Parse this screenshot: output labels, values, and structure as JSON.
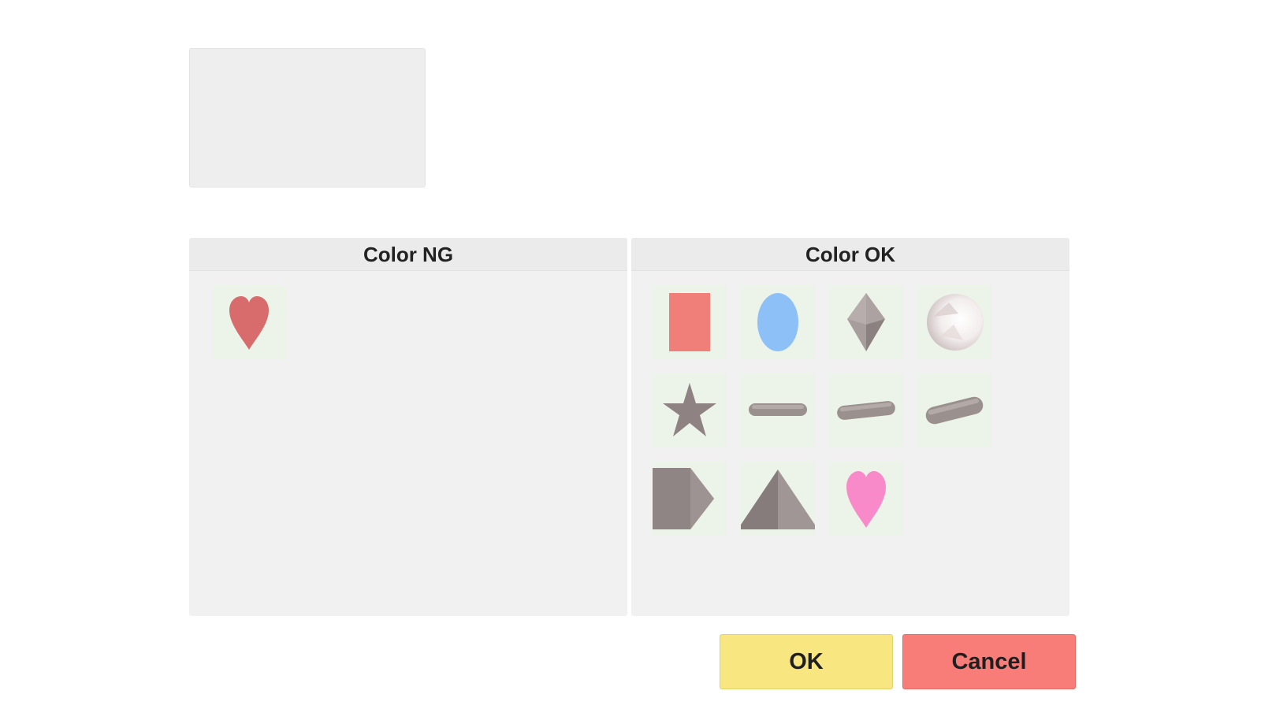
{
  "panels": {
    "ng": {
      "title": "Color NG"
    },
    "ok": {
      "title": "Color OK"
    }
  },
  "buttons": {
    "ok_label": "OK",
    "cancel_label": "Cancel"
  },
  "ng_items": [
    {
      "shape": "heart-icon",
      "color": "#d86b6b"
    }
  ],
  "ok_items": [
    {
      "shape": "rectangle-icon",
      "color": "#f07f7a"
    },
    {
      "shape": "oval-icon",
      "color": "#8ec0f8"
    },
    {
      "shape": "diamond-icon",
      "color": "#9a908f"
    },
    {
      "shape": "sphere-icon",
      "color": "#f2f0f0"
    },
    {
      "shape": "star-icon",
      "color": "#8e8382"
    },
    {
      "shape": "stick-icon",
      "color": "#9a908e"
    },
    {
      "shape": "stick-icon",
      "color": "#9a908e"
    },
    {
      "shape": "stick-icon",
      "color": "#9a908e"
    },
    {
      "shape": "pentagon-icon",
      "color": "#8e8584"
    },
    {
      "shape": "pyramid-icon",
      "color": "#938a89"
    },
    {
      "shape": "heart-icon",
      "color": "#f88ac9"
    }
  ]
}
